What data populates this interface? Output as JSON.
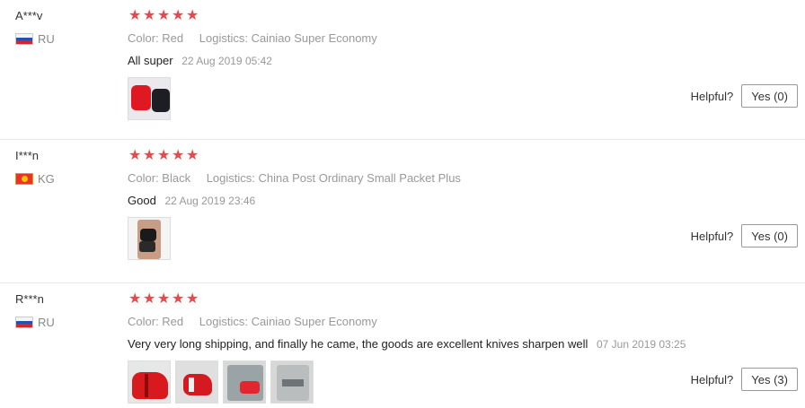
{
  "helpful_label": "Helpful?",
  "reviews": [
    {
      "user": "A***v",
      "country": "RU",
      "rating": 5,
      "color": "Color: Red",
      "logistics": "Logistics: Cainiao Super Economy",
      "text": "All super",
      "date": "22 Aug 2019 05:42",
      "photos": [
        "red-and-black-sharpener-photo"
      ],
      "yes": "Yes (0)"
    },
    {
      "user": "I***n",
      "country": "KG",
      "rating": 5,
      "color": "Color: Black",
      "logistics": "Logistics: China Post Ordinary Small Packet Plus",
      "text": "Good",
      "date": "22 Aug 2019 23:46",
      "photos": [
        "hand-holding-black-sharpener-photo"
      ],
      "yes": "Yes (0)"
    },
    {
      "user": "R***n",
      "country": "RU",
      "rating": 5,
      "color": "Color: Red",
      "logistics": "Logistics: Cainiao Super Economy",
      "text": "Very very long shipping, and finally he came, the goods are excellent knives sharpen well",
      "date": "07 Jun 2019 03:25",
      "photos": [
        "red-sharpener-photo-1",
        "red-sharpener-photo-2",
        "sharpener-in-bag-photo",
        "packaging-photo"
      ],
      "yes": "Yes (3)"
    }
  ],
  "colors": {
    "star": "#e9474a",
    "muted_text": "#999999",
    "divider": "#e8e8e8"
  }
}
